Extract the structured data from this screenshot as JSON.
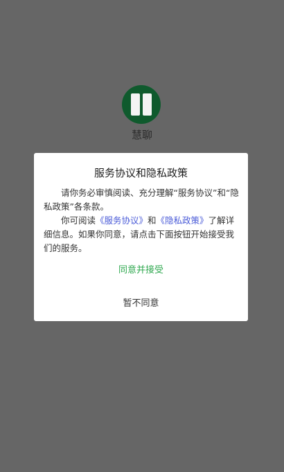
{
  "app": {
    "name": "慧聊",
    "logo_icon": "app-logo-icon",
    "logo_color": "#0f5a2d"
  },
  "dialog": {
    "title": "服务协议和隐私政策",
    "paragraph1": "请你务必审慎阅读、充分理解“服务协议”和“隐私政策”各条款。",
    "paragraph2_prefix": "你可阅读",
    "service_agreement_link": "《服务协议》",
    "paragraph2_and": "和",
    "privacy_policy_link": "《隐私政策》",
    "paragraph2_suffix": "了解详细信息。如果你同意，请点击下面按钮开始接受我们的服务。",
    "accept_label": "同意并接受",
    "decline_label": "暂不同意"
  },
  "colors": {
    "overlay": "#666666",
    "accept": "#2fa84f",
    "link": "#4a5bd8"
  }
}
